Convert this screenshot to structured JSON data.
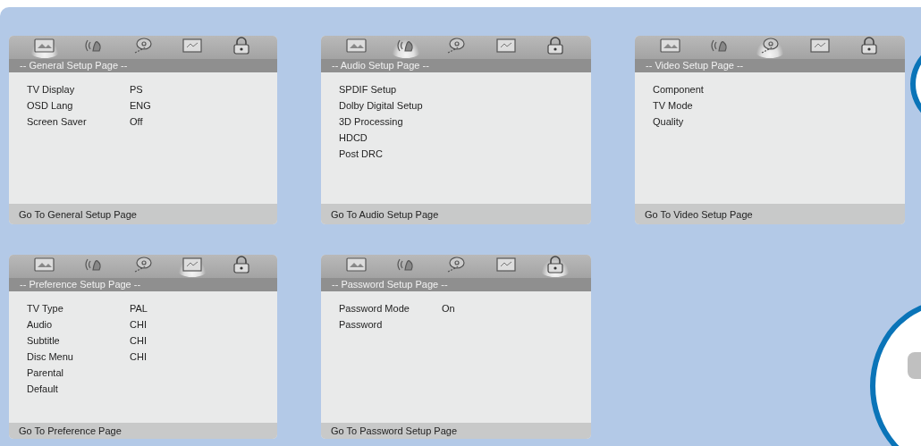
{
  "panels": [
    {
      "title": "-- General Setup Page --",
      "icons": [
        {
          "selected": true
        },
        {
          "selected": false
        },
        {
          "selected": false
        },
        {
          "selected": false
        },
        {
          "selected": false
        }
      ],
      "items": [
        {
          "label": "TV Display",
          "value": "PS"
        },
        {
          "label": "OSD Lang",
          "value": "ENG"
        },
        {
          "label": "Screen Saver",
          "value": "Off"
        }
      ],
      "footer": "Go To General Setup Page"
    },
    {
      "title": "-- Audio Setup Page --",
      "icons": [
        {
          "selected": false
        },
        {
          "selected": true
        },
        {
          "selected": false
        },
        {
          "selected": false
        },
        {
          "selected": false
        }
      ],
      "items": [
        {
          "label": "SPDIF Setup"
        },
        {
          "label": "Dolby Digital Setup"
        },
        {
          "label": "3D Processing"
        },
        {
          "label": "HDCD"
        },
        {
          "label": "Post DRC"
        }
      ],
      "footer": "Go To Audio Setup Page"
    },
    {
      "title": "-- Video Setup Page --",
      "icons": [
        {
          "selected": false
        },
        {
          "selected": false
        },
        {
          "selected": true
        },
        {
          "selected": false
        },
        {
          "selected": false
        }
      ],
      "items": [
        {
          "label": "Component"
        },
        {
          "label": "TV Mode"
        },
        {
          "label": "Quality"
        }
      ],
      "footer": "Go To Video Setup Page"
    },
    {
      "title": "-- Preference Setup Page --",
      "icons": [
        {
          "selected": false
        },
        {
          "selected": false
        },
        {
          "selected": false
        },
        {
          "selected": true
        },
        {
          "selected": false
        }
      ],
      "items": [
        {
          "label": "TV Type",
          "value": "PAL"
        },
        {
          "label": "Audio",
          "value": "CHI"
        },
        {
          "label": "Subtitle",
          "value": "CHI"
        },
        {
          "label": "Disc Menu",
          "value": "CHI"
        },
        {
          "label": "Parental"
        },
        {
          "label": "Default"
        }
      ],
      "footer": "Go To Preference Page"
    },
    {
      "title": "-- Password Setup Page --",
      "icons": [
        {
          "selected": false
        },
        {
          "selected": false
        },
        {
          "selected": false
        },
        {
          "selected": false
        },
        {
          "selected": true
        }
      ],
      "items": [
        {
          "label": "Password Mode",
          "value": "On"
        },
        {
          "label": "Password"
        }
      ],
      "footer": "Go To Password Setup Page"
    }
  ]
}
